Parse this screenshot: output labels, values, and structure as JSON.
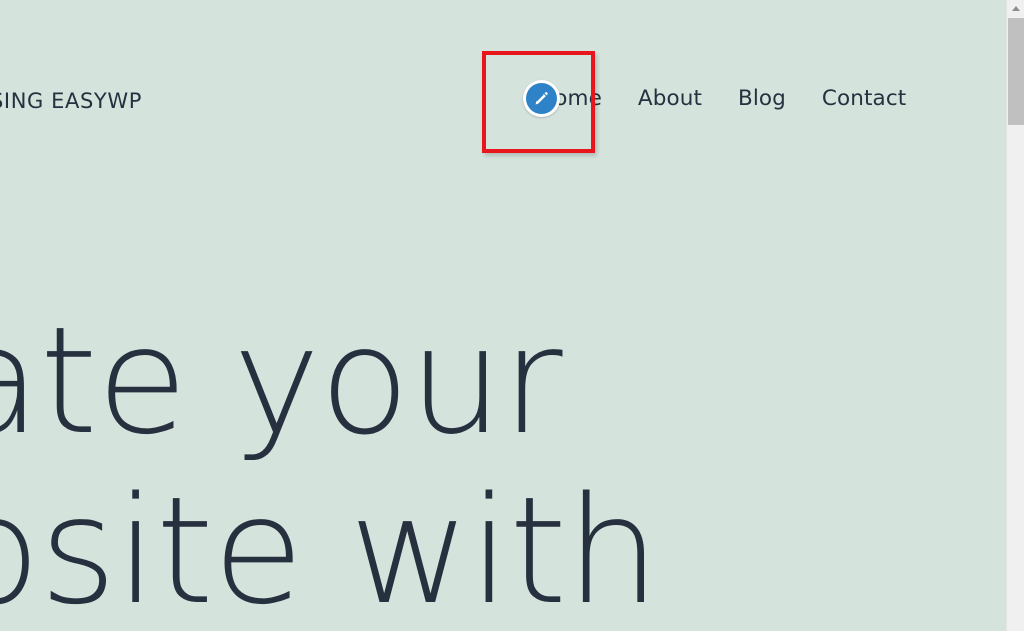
{
  "browser": {
    "scrollbar": {
      "up_arrow_icon": "scroll-up-arrow-icon",
      "thumb_name": "scroll-thumb"
    }
  },
  "site": {
    "brand": {
      "text": "USING EASYWP"
    },
    "edit_button": {
      "icon": "pencil-edit-icon",
      "label": "Edit",
      "disc_color": "#2e82c8",
      "glyph_color": "#ffffff",
      "ring_color": "#ffffff"
    },
    "nav": {
      "items": [
        {
          "label": "Home",
          "name": "nav-link-home"
        },
        {
          "label": "About",
          "name": "nav-link-about"
        },
        {
          "label": "Blog",
          "name": "nav-link-blog"
        },
        {
          "label": "Contact",
          "name": "nav-link-contact"
        }
      ]
    },
    "hero": {
      "line1": "ate your",
      "line2": "osite with"
    },
    "colors": {
      "background": "#d5e3dd",
      "text": "#26303f",
      "accent_blue": "#2e82c8",
      "highlight_red": "#e8161c"
    }
  },
  "annotation": {
    "highlight": {
      "name": "edit-button-highlight",
      "color": "#e8161c"
    }
  }
}
